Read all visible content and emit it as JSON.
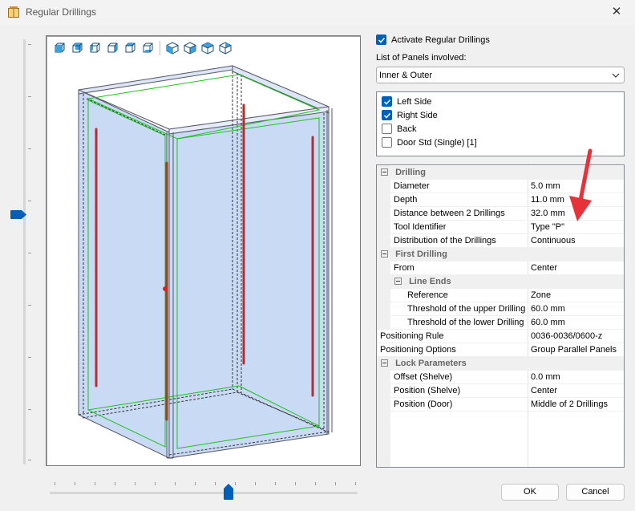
{
  "window": {
    "title": "Regular Drillings",
    "close_glyph": "✕",
    "icon": "cabinet-app-icon"
  },
  "options": {
    "activate_label": "Activate Regular Drillings",
    "activate_checked": true,
    "list_label": "List of Panels involved:",
    "combo_value": "Inner & Outer"
  },
  "panels": [
    {
      "label": "Left Side",
      "checked": true
    },
    {
      "label": "Right Side",
      "checked": true
    },
    {
      "label": "Back",
      "checked": false
    },
    {
      "label": "Door Std (Single) [1]",
      "checked": false
    }
  ],
  "properties": {
    "drilling": {
      "title": "Drilling",
      "rows": [
        {
          "name": "Diameter",
          "value": "5.0 mm"
        },
        {
          "name": "Depth",
          "value": "11.0 mm"
        },
        {
          "name": "Distance between 2 Drillings",
          "value": "32.0 mm"
        },
        {
          "name": "Tool Identifier",
          "value": "Type \"P\""
        },
        {
          "name": "Distribution of the Drillings",
          "value": "Continuous"
        }
      ]
    },
    "first_drilling": {
      "title": "First Drilling",
      "from": {
        "name": "From",
        "value": "Center"
      },
      "line_ends": {
        "title": "Line Ends",
        "rows": [
          {
            "name": "Reference",
            "value": "Zone"
          },
          {
            "name": "Threshold of the upper Drilling",
            "value": "60.0 mm"
          },
          {
            "name": "Threshold of the lower Drilling",
            "value": "60.0 mm"
          }
        ]
      }
    },
    "top_rows": [
      {
        "name": "Positioning Rule",
        "value": "0036-0036/0600-z"
      },
      {
        "name": "Positioning Options",
        "value": "Group Parallel Panels"
      }
    ],
    "lock": {
      "title": "Lock Parameters",
      "rows": [
        {
          "name": "Offset (Shelve)",
          "value": "0.0 mm"
        },
        {
          "name": "Position (Shelve)",
          "value": "Center"
        },
        {
          "name": "Position (Door)",
          "value": "Middle of 2 Drillings"
        }
      ]
    }
  },
  "buttons": {
    "ok": "OK",
    "cancel": "Cancel"
  },
  "colors": {
    "accent": "#005fb8",
    "panel_fill": "#c9daf5",
    "drill_line": "#b03030",
    "edge_green": "#20c020",
    "annotation_arrow": "#e8323a"
  }
}
